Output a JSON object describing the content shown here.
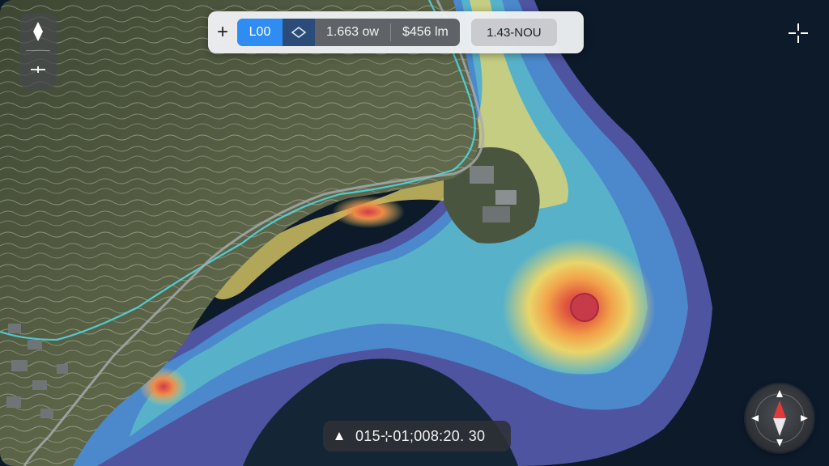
{
  "toolbar": {
    "add_icon": "plus-icon",
    "mode_label": "L00",
    "shape_icon": "polygon-select-icon",
    "measure_1": "1.663 ow",
    "measure_2": "$456 lm",
    "chip_label": "1.43-NOU"
  },
  "left_controls": {
    "north_icon": "north-arrow-icon",
    "center_icon": "crosshair-icon"
  },
  "top_right_icon": "target-crosshair-icon",
  "readout": {
    "icon": "triangle-up-icon",
    "text": "015⊹01;008:20. 30"
  },
  "compass_icon": "compass-icon",
  "colors": {
    "accent": "#2f8cf2",
    "water_deep": "#0d1a2a",
    "heat_hot": "#d9474a",
    "heat_warm": "#f2a24a",
    "heat_mid": "#e9d56a",
    "heat_cool": "#59b7c9",
    "heat_cold": "#5a5fb5",
    "road": "#4fd6e0"
  }
}
